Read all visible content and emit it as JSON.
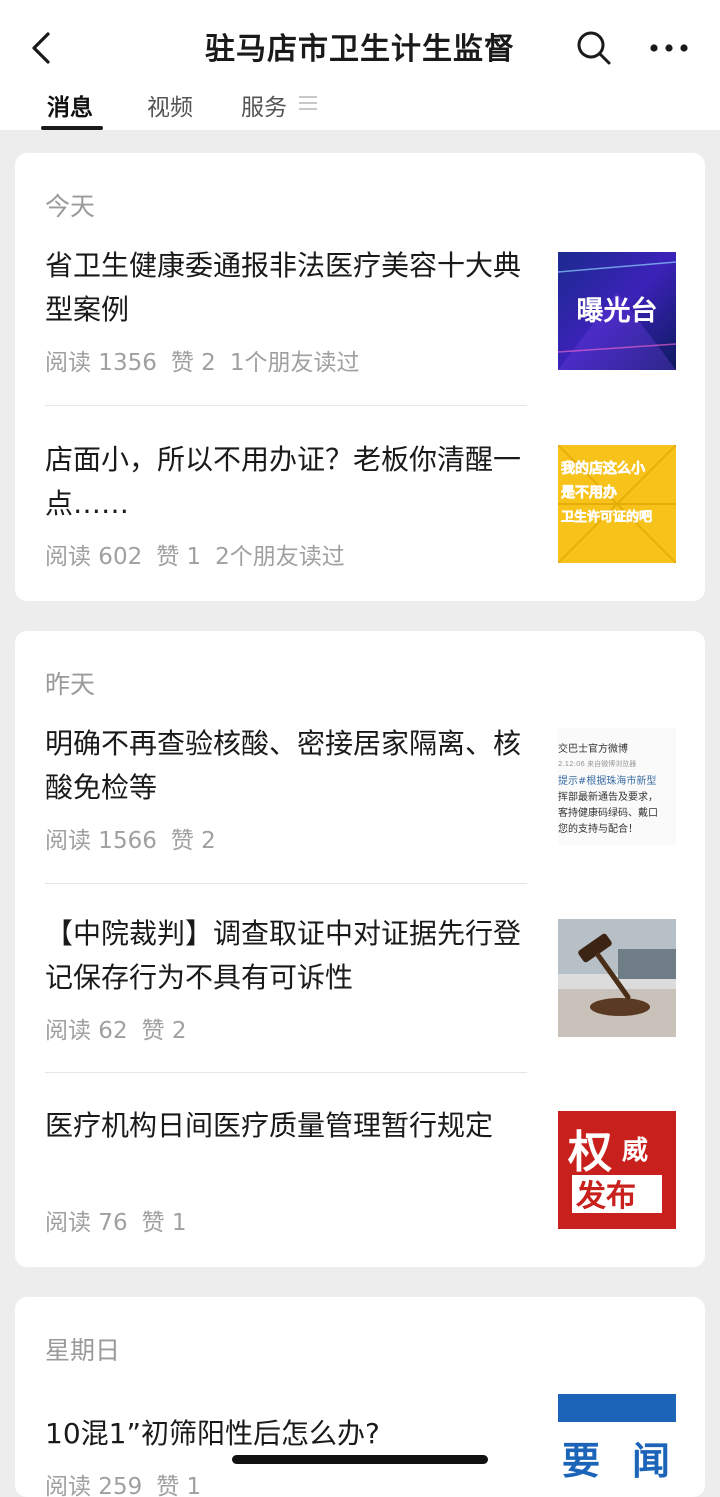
{
  "header": {
    "title": "驻马店市卫生计生监督",
    "back_icon": "chevron-left-icon",
    "search_icon": "search-icon",
    "more_icon": "more-dots-icon"
  },
  "tabs": [
    {
      "label": "消息",
      "active": true
    },
    {
      "label": "视频",
      "active": false
    },
    {
      "label": "服务",
      "active": false
    }
  ],
  "sections": [
    {
      "day": "今天",
      "articles": [
        {
          "title": "省卫生健康委通报非法医疗美容十大典型案例",
          "reads": "阅读 1356",
          "likes": "赞 2",
          "friends": "1个朋友读过",
          "thumb_text": "曝光台"
        },
        {
          "title": "店面小，所以不用办证？老板你清醒一点……",
          "reads": "阅读 602",
          "likes": "赞 1",
          "friends": "2个朋友读过",
          "thumb_text": [
            "我的店这么小",
            "是不用办",
            "卫生许可证的吧"
          ]
        }
      ]
    },
    {
      "day": "昨天",
      "articles": [
        {
          "title": "明确不再查验核酸、密接居家隔离、核酸免检等",
          "reads": "阅读 1566",
          "likes": "赞 2",
          "thumb_text": [
            "交巴士官方微博",
            "2.12:06 来自微博浏览器",
            "提示#根据珠海市新型",
            "挥部最新通告及要求，",
            "客持健康码绿码、戴口",
            "您的支持与配合！"
          ]
        },
        {
          "title": "【中院裁判】调查取证中对证据先行登记保存行为不具有可诉性",
          "reads": "阅读 62",
          "likes": "赞 2"
        },
        {
          "title": "医疗机构日间医疗质量管理暂行规定",
          "reads": "阅读 76",
          "likes": "赞 1",
          "thumb_text": [
            "权",
            "威",
            "发布"
          ]
        }
      ]
    },
    {
      "day": "星期日",
      "articles": [
        {
          "title": "10混1”初筛阳性后怎么办?",
          "reads": "阅读 259",
          "likes": "赞 1",
          "thumb_text": [
            "要",
            "闻"
          ]
        }
      ]
    }
  ]
}
